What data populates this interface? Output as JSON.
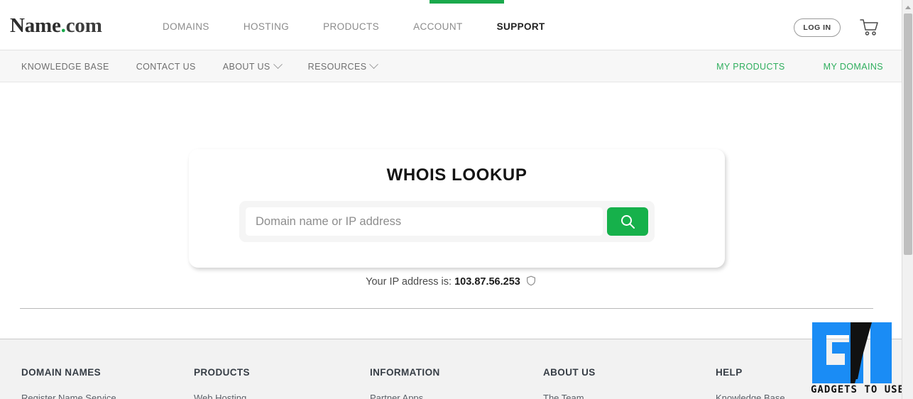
{
  "header": {
    "logo": {
      "name": "Name",
      "dot": ".",
      "tld": "com"
    },
    "nav": [
      {
        "label": "DOMAINS",
        "active": false
      },
      {
        "label": "HOSTING",
        "active": false
      },
      {
        "label": "PRODUCTS",
        "active": false
      },
      {
        "label": "ACCOUNT",
        "active": false
      },
      {
        "label": "SUPPORT",
        "active": true
      }
    ],
    "login_label": "LOG IN",
    "cart_icon": "shopping-cart-icon",
    "active_indicator_color": "#1aa94c"
  },
  "subnav": {
    "left": [
      {
        "label": "KNOWLEDGE BASE",
        "caret": false
      },
      {
        "label": "CONTACT US",
        "caret": false
      },
      {
        "label": "ABOUT US",
        "caret": true
      },
      {
        "label": "RESOURCES",
        "caret": true
      }
    ],
    "right": [
      {
        "label": "MY PRODUCTS"
      },
      {
        "label": "MY DOMAINS"
      }
    ],
    "link_color": "#2eae5d"
  },
  "main": {
    "card_title": "WHOIS LOOKUP",
    "search_placeholder": "Domain name or IP address",
    "search_value": "",
    "search_icon": "magnifier-icon",
    "search_button_color": "#16b14b",
    "highlight_border_color": "#e01b1b",
    "ip_label": "Your IP address is:",
    "ip_value": "103.87.56.253",
    "ip_icon": "shield-icon"
  },
  "footer": {
    "columns": [
      {
        "heading": "DOMAIN NAMES",
        "link": "Register Name Service"
      },
      {
        "heading": "PRODUCTS",
        "link": "Web Hosting"
      },
      {
        "heading": "INFORMATION",
        "link": "Partner Apps"
      },
      {
        "heading": "ABOUT US",
        "link": "The Team"
      },
      {
        "heading": "HELP",
        "link": "Knowledge Base"
      }
    ]
  },
  "watermark": {
    "label": "GADGETS TO USE",
    "accent": "#1a8cf5"
  },
  "scrollbar": {
    "up_icon": "scroll-up-arrow-icon"
  }
}
